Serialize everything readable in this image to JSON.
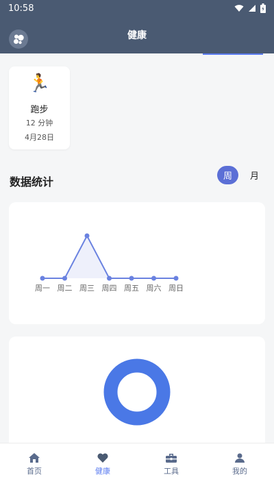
{
  "status_bar": {
    "time": "10:58"
  },
  "header": {
    "title": "健康"
  },
  "activity": {
    "emoji": "🏃",
    "name": "跑步",
    "duration": "12 分钟",
    "date": "4月28日"
  },
  "stats": {
    "title": "数据统计",
    "period_week": "周",
    "period_month": "月"
  },
  "chart_data": {
    "type": "area",
    "categories": [
      "周一",
      "周二",
      "周三",
      "周四",
      "周五",
      "周六",
      "周日"
    ],
    "values": [
      0,
      0,
      12,
      0,
      0,
      0,
      0
    ],
    "color": "#6a82e0"
  },
  "donut": {
    "color": "#4a78e6"
  },
  "nav": [
    {
      "label": "首页",
      "icon": "home-icon"
    },
    {
      "label": "健康",
      "icon": "heart-icon"
    },
    {
      "label": "工具",
      "icon": "toolbox-icon"
    },
    {
      "label": "我的",
      "icon": "user-icon"
    }
  ]
}
